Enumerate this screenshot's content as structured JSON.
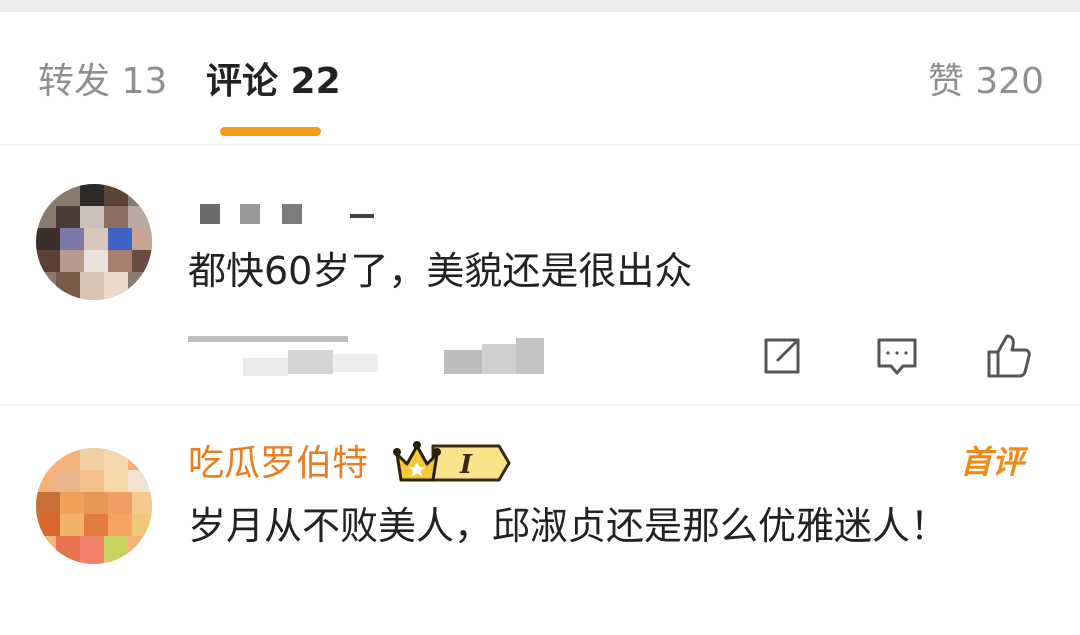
{
  "tabs": {
    "repost_label": "转发 13",
    "comment_label": "评论 22",
    "like_label": "赞 320",
    "active": "comment"
  },
  "colors": {
    "accent": "#f59a1b",
    "username": "#ea7d21",
    "muted": "#8f8f8f"
  },
  "comments": [
    {
      "username": "",
      "text": "都快60岁了，美貌还是很出众",
      "actions": [
        "share-icon",
        "reply-icon",
        "like-icon"
      ]
    },
    {
      "username": "吃瓜罗伯特",
      "vip_level": "I",
      "badge": "首评",
      "text": "岁月从不败美人，邱淑贞还是那么优雅迷人！"
    }
  ]
}
